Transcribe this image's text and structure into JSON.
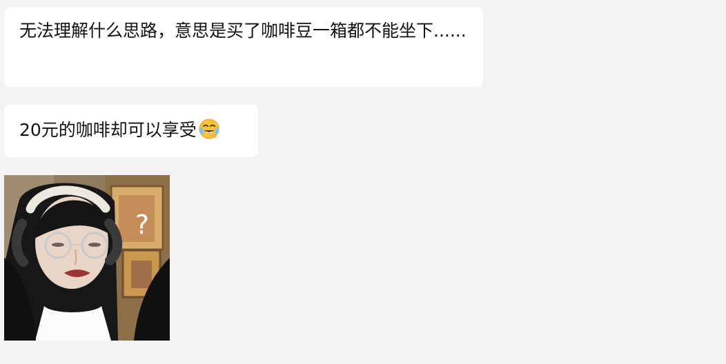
{
  "messages": [
    {
      "text": "无法理解什么思路，意思是买了咖啡豆一箱都不能坐下......"
    },
    {
      "text": "20元的咖啡却可以享受",
      "emoji": "laughing-crying-face-icon"
    }
  ],
  "image_message": {
    "overlay_text": "?"
  },
  "colors": {
    "background": "#f3f3f3",
    "bubble": "#ffffff",
    "text": "#111111"
  }
}
